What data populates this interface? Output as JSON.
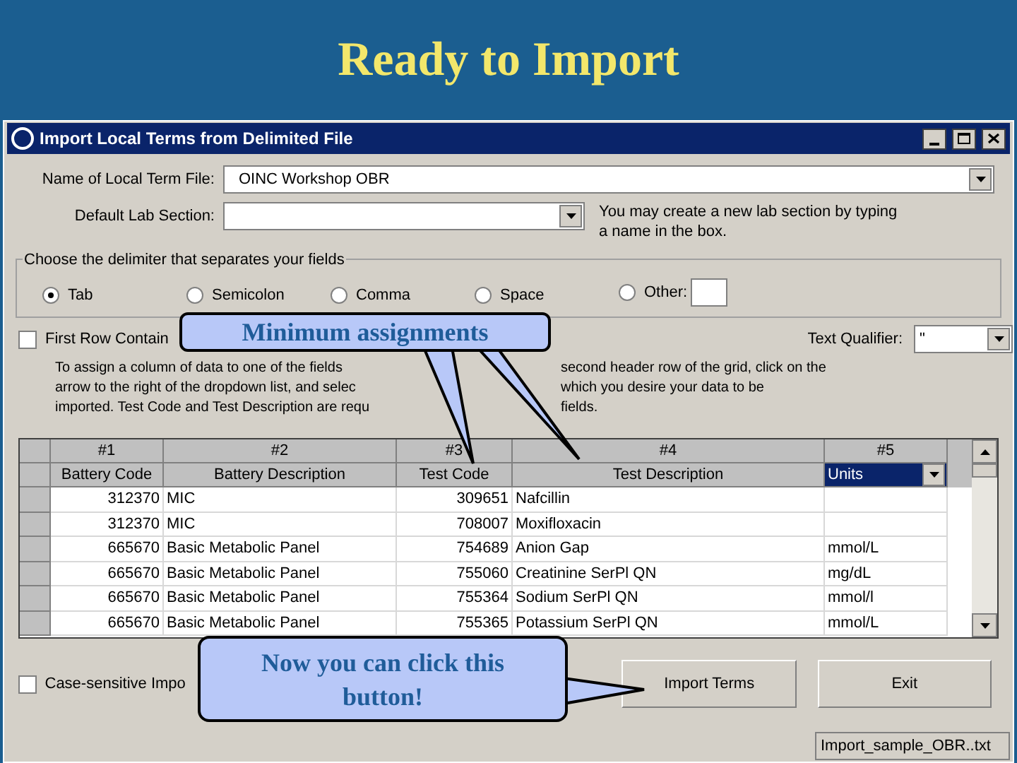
{
  "slide_title": "Ready to Import",
  "window": {
    "title": "Import Local Terms from Delimited File"
  },
  "term_file": {
    "label": "Name of Local Term File:",
    "value": "OINC Workshop OBR"
  },
  "lab_section": {
    "label": "Default Lab Section:",
    "hint": "You may create a new lab section by typing a name in the box."
  },
  "delimiter": {
    "legend": "Choose the delimiter that separates your fields",
    "options": [
      {
        "label": "Tab",
        "selected": true
      },
      {
        "label": "Semicolon",
        "selected": false
      },
      {
        "label": "Comma",
        "selected": false
      },
      {
        "label": "Space",
        "selected": false
      },
      {
        "label": "Other:",
        "selected": false
      }
    ]
  },
  "first_row": {
    "label": "First Row Contain",
    "checked": false
  },
  "text_qualifier": {
    "label": "Text Qualifier:",
    "value": "\""
  },
  "instructions": [
    [
      "To assign a column of data to one of the fields",
      "second header row of the grid, click on the"
    ],
    [
      "arrow to the right of the dropdown list, and selec",
      "which you desire your data to be"
    ],
    [
      "imported.  Test Code and Test Description are requ",
      "fields."
    ]
  ],
  "grid": {
    "columns": [
      {
        "number": "#1",
        "label": "Battery Code",
        "kind": "plain"
      },
      {
        "number": "#2",
        "label": "Battery Description",
        "kind": "plain"
      },
      {
        "number": "#3",
        "label": "Test Code",
        "kind": "plain"
      },
      {
        "number": "#4",
        "label": "Test Description",
        "kind": "plain"
      },
      {
        "number": "#5",
        "label": "Units",
        "kind": "dropdown"
      }
    ],
    "rows": [
      [
        "312370",
        "MIC",
        "309651",
        "Nafcillin",
        ""
      ],
      [
        "312370",
        "MIC",
        "708007",
        "Moxifloxacin",
        ""
      ],
      [
        "665670",
        "Basic Metabolic Panel",
        "754689",
        "Anion Gap",
        "mmol/L"
      ],
      [
        "665670",
        "Basic Metabolic Panel",
        "755060",
        "Creatinine SerPl QN",
        "mg/dL"
      ],
      [
        "665670",
        "Basic Metabolic Panel",
        "755364",
        "Sodium SerPl QN",
        "mmol/l"
      ],
      [
        "665670",
        "Basic Metabolic Panel",
        "755365",
        "Potassium SerPl QN",
        "mmol/L"
      ]
    ]
  },
  "case_sensitive": {
    "label": "Case-sensitive Impo",
    "checked": false
  },
  "buttons": [
    "Import Terms",
    "Exit"
  ],
  "status_bar": {
    "file": "Import_sample_OBR..txt"
  },
  "callouts": [
    {
      "text": "Minimum assignments"
    },
    {
      "text": "Now you can click this button!"
    }
  ]
}
